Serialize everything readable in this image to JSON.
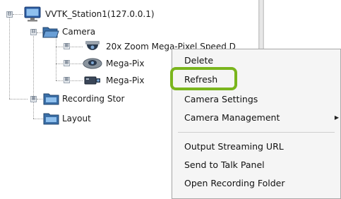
{
  "tree": {
    "station": {
      "label": "VVTK_Station1(127.0.0.1)",
      "expander": "⊟"
    },
    "camera_group": {
      "label": "Camera",
      "expander": "⊟"
    },
    "cameras": [
      {
        "label": "20x Zoom Mega-Pixel Speed D",
        "expander": "⊞",
        "icon": "speed-dome-camera-icon"
      },
      {
        "label": "Mega-Pix",
        "expander": "⊞",
        "icon": "fisheye-camera-icon"
      },
      {
        "label": "Mega-Pix",
        "expander": "⊞",
        "icon": "box-camera-icon"
      }
    ],
    "recording": {
      "label": "Recording Stor",
      "expander": "⊞"
    },
    "layout": {
      "label": "Layout"
    }
  },
  "context_menu": {
    "items": [
      {
        "label": "Delete"
      },
      {
        "label": "Refresh"
      },
      {
        "label": "Camera Settings"
      },
      {
        "label": "Camera Management",
        "submenu_arrow": "▶"
      },
      {
        "label": "Output Streaming URL"
      },
      {
        "label": "Send to Talk Panel"
      },
      {
        "label": "Open Recording Folder"
      }
    ]
  },
  "colors": {
    "highlight": "#7ab51d",
    "folder": "#3a6fa8",
    "monitor": "#2a5aa0"
  }
}
